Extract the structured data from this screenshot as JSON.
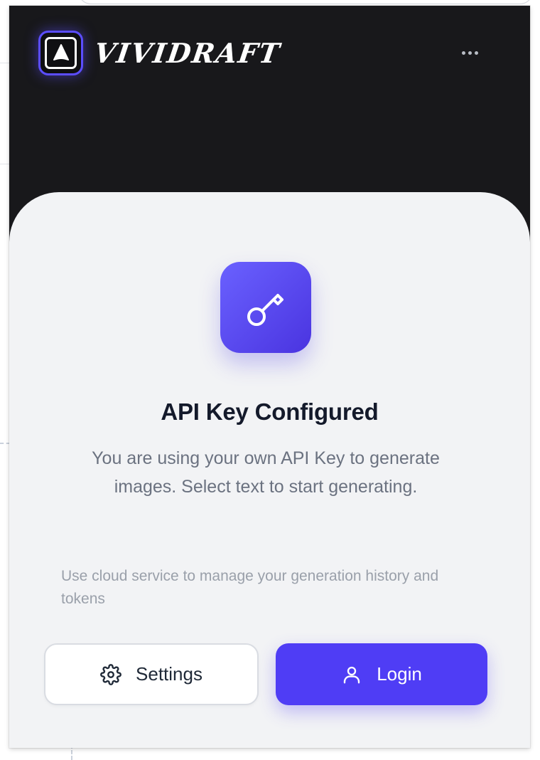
{
  "app": {
    "brand_name": "Vividraft",
    "accent_color": "#4f3df5",
    "header_bg": "#18181b"
  },
  "header": {
    "menu_icon": "more-horizontal-icon",
    "logo_icon": "arrow-up-logo-icon"
  },
  "status": {
    "icon": "key-icon",
    "title": "API Key Configured",
    "description": "You are using your own API Key to generate images. Select text to start generating.",
    "cloud_note": "Use cloud service to manage your generation history and tokens"
  },
  "actions": {
    "settings": {
      "label": "Settings",
      "icon": "gear-icon"
    },
    "login": {
      "label": "Login",
      "icon": "user-icon"
    }
  }
}
